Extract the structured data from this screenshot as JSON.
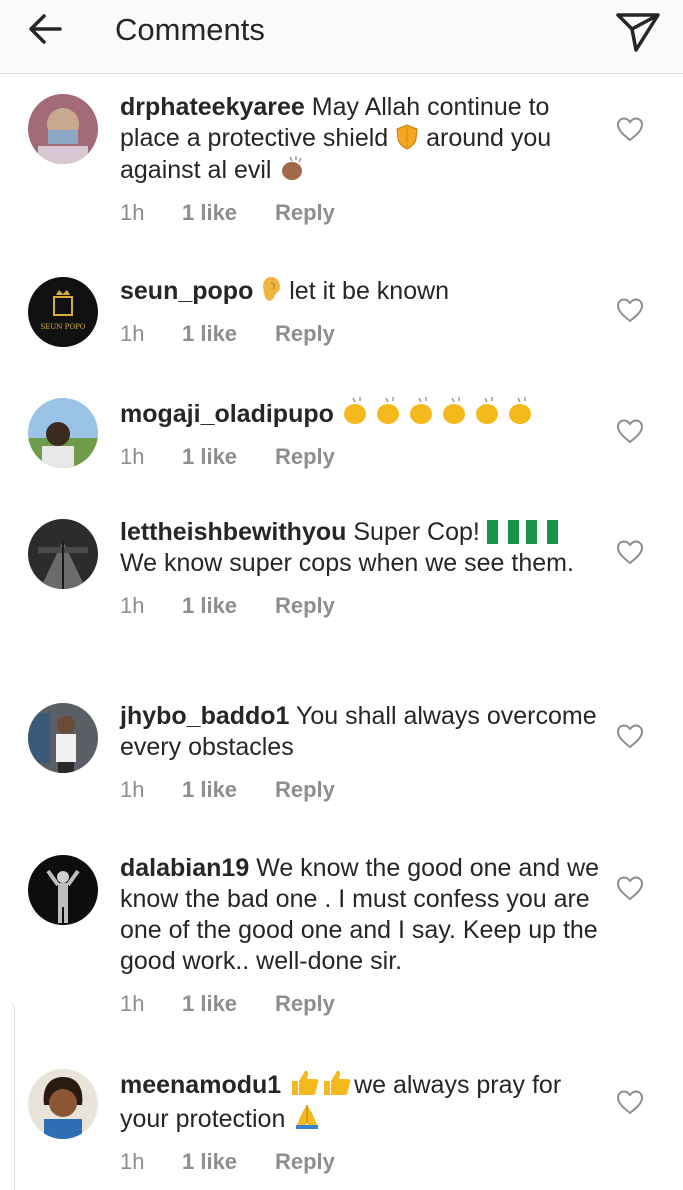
{
  "header": {
    "title": "Comments"
  },
  "comments": [
    {
      "username": "drphateekyaree",
      "parts": [
        "May Allah continue to place a protective shield ",
        " around you against al evil "
      ],
      "time": "1h",
      "likes": "1 like",
      "reply": "Reply"
    },
    {
      "username": "seun_popo",
      "parts": [
        " let it be known"
      ],
      "time": "1h",
      "likes": "1 like",
      "reply": "Reply",
      "avatar_text": "SEUN POPO"
    },
    {
      "username": "mogaji_oladipupo",
      "parts": [
        " "
      ],
      "time": "1h",
      "likes": "1 like",
      "reply": "Reply"
    },
    {
      "username": "lettheishbewithyou",
      "parts": [
        "Super Cop! ",
        " ",
        " We know super cops when we see them."
      ],
      "time": "1h",
      "likes": "1 like",
      "reply": "Reply"
    },
    {
      "username": "jhybo_baddo1",
      "parts": [
        "You shall always overcome every obstacles"
      ],
      "time": "1h",
      "likes": "1 like",
      "reply": "Reply"
    },
    {
      "username": "dalabian19",
      "parts": [
        "We know the good one and we know the bad one . I must confess you are one of the good one and I say. Keep up the good work.. well-done sir."
      ],
      "time": "1h",
      "likes": "1 like",
      "reply": "Reply"
    },
    {
      "username": "meenamodu1",
      "parts": [
        " ",
        "we always pray for your protection "
      ],
      "time": "1h",
      "likes": "1 like",
      "reply": "Reply"
    }
  ],
  "colors": {
    "text": "#262626",
    "meta": "#8e8e8e",
    "border": "#dbdbdb"
  },
  "icons": [
    "back-arrow-icon",
    "direct-message-icon",
    "heart-icon",
    "shield-emoji",
    "clap-emoji",
    "ear-emoji",
    "nigeria-flag-emoji",
    "thumbs-up-emoji",
    "praying-hands-emoji"
  ]
}
